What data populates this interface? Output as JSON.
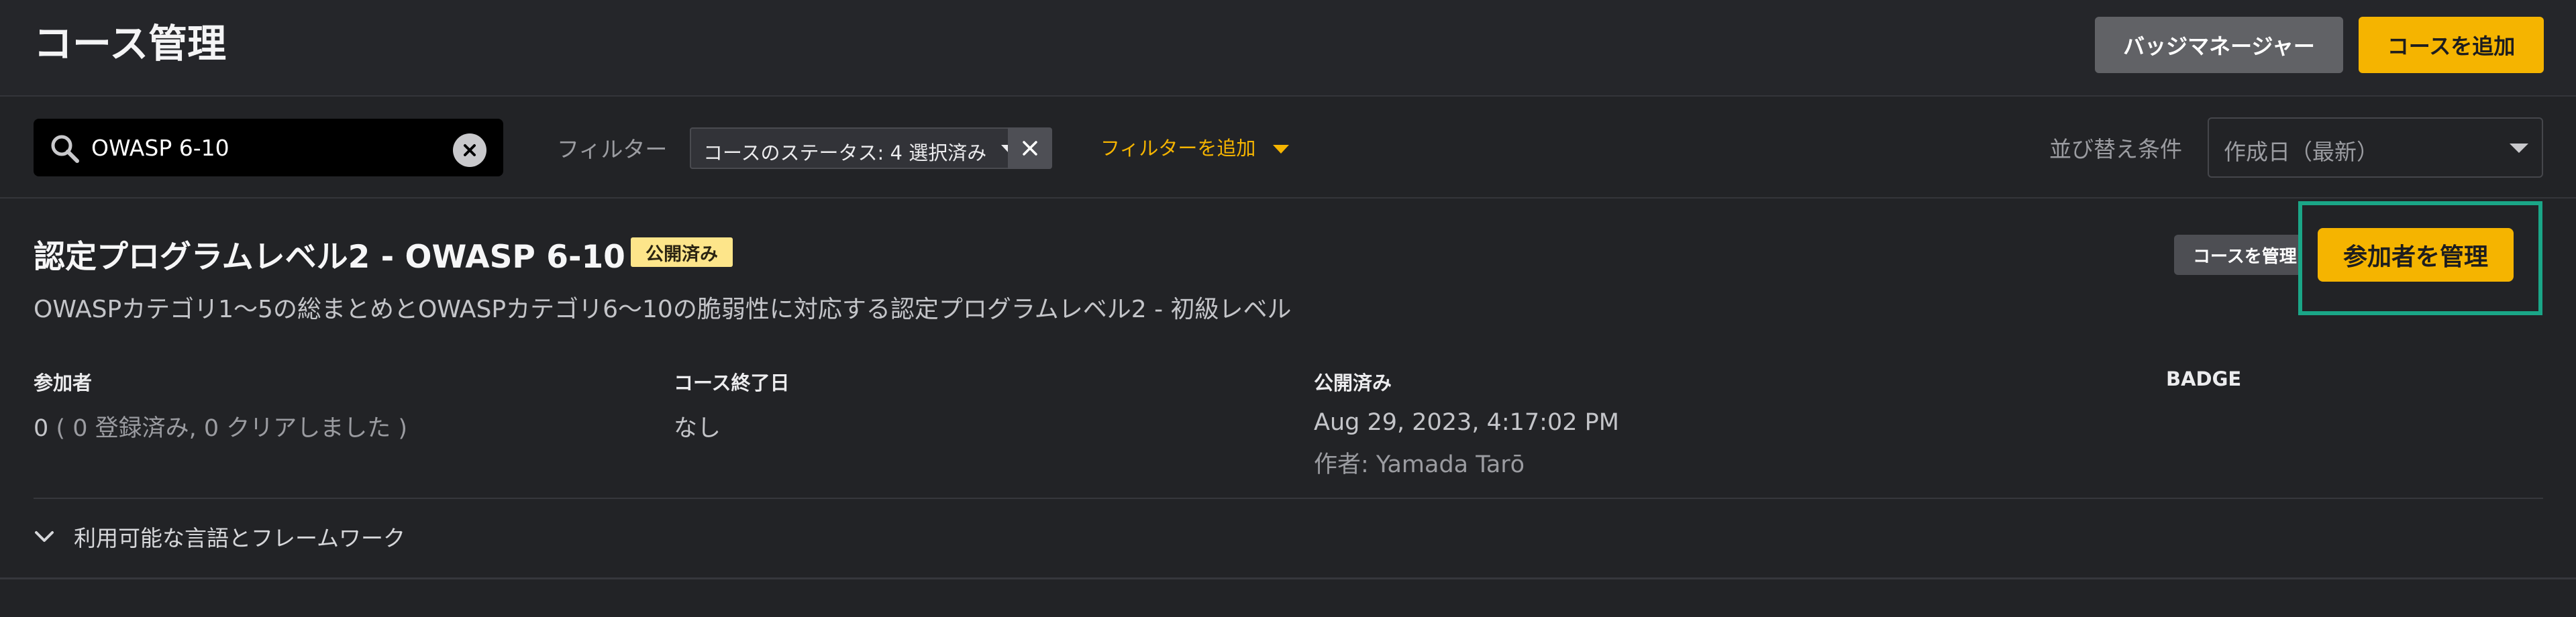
{
  "header": {
    "title": "コース管理",
    "badge_manager_label": "バッジマネージャー",
    "add_course_label": "コースを追加"
  },
  "filters": {
    "search_value": "OWASP 6-10",
    "filter_label": "フィルター",
    "chip_text": "コースのステータス: 4 選択済み",
    "add_filter_label": "フィルターを追加",
    "sort_label": "並び替え条件",
    "sort_value": "作成日（最新）"
  },
  "course": {
    "title": "認定プログラムレベル2 - OWASP 6-10",
    "status": "公開済み",
    "description": "OWASPカテゴリ1〜5の総まとめとOWASPカテゴリ6〜10の脆弱性に対応する認定プログラムレベル2 - 初級レベル",
    "manage_course_label": "コースを管理",
    "manage_participants_label": "参加者を管理",
    "participants_label": "参加者",
    "participants_count": "0",
    "participants_detail": "( 0 登録済み, 0 クリアしました )",
    "end_date_label": "コース終了日",
    "end_date_value": "なし",
    "published_label": "公開済み",
    "published_value": "Aug 29, 2023, 4:17:02 PM",
    "author": "作者: Yamada Tarō",
    "badge_label": "BADGE",
    "languages_toggle": "利用可能な言語とフレームワーク"
  },
  "colors": {
    "accent": "#f5b400",
    "highlight": "#1aa687",
    "status_badge": "#fde58a"
  }
}
